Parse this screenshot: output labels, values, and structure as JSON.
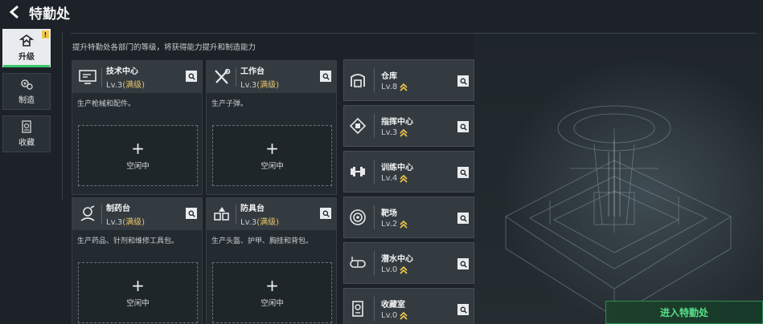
{
  "header": {
    "title": "特勤处"
  },
  "sidenav": [
    {
      "label": "升级",
      "icon": "upgrade-icon",
      "active": true,
      "badge": "!"
    },
    {
      "label": "制造",
      "icon": "gears-icon",
      "active": false
    },
    {
      "label": "收藏",
      "icon": "collection-icon",
      "active": false
    }
  ],
  "description": "提升特勤处各部门的等级，将获得能力提升和制造能力",
  "workshops": [
    {
      "name": "技术中心",
      "level": "Lv.3",
      "maxed": "(满级)",
      "desc": "生产枪械和配件。",
      "slot_label": "空闲中",
      "icon": "monitor-icon"
    },
    {
      "name": "工作台",
      "level": "Lv.3",
      "maxed": "(满级)",
      "desc": "生产子弹。",
      "slot_label": "空闲中",
      "icon": "tools-icon"
    },
    {
      "name": "制药台",
      "level": "Lv.3",
      "maxed": "(满级)",
      "desc": "生产药品、针剂和维修工具包。",
      "slot_label": "空闲中",
      "icon": "microscope-icon"
    },
    {
      "name": "防具台",
      "level": "Lv.3",
      "maxed": "(满级)",
      "desc": "生产头盔、护甲、胸挂和背包。",
      "slot_label": "空闲中",
      "icon": "armor-icon"
    }
  ],
  "facilities": [
    {
      "name": "仓库",
      "level": "Lv.8",
      "icon": "warehouse-icon"
    },
    {
      "name": "指挥中心",
      "level": "Lv.3",
      "icon": "command-chip-icon"
    },
    {
      "name": "训练中心",
      "level": "Lv.4",
      "icon": "dumbbell-icon"
    },
    {
      "name": "靶场",
      "level": "Lv.2",
      "icon": "target-icon"
    },
    {
      "name": "潜水中心",
      "level": "Lv.0",
      "icon": "diving-mask-icon"
    },
    {
      "name": "收藏室",
      "level": "Lv.0",
      "icon": "trophy-icon"
    }
  ],
  "enter_button": "进入特勤处",
  "colors": {
    "accent_green": "#39c46a",
    "maxed_gold": "#e8c46a",
    "upgrade_chevron": "#f2c94c"
  }
}
